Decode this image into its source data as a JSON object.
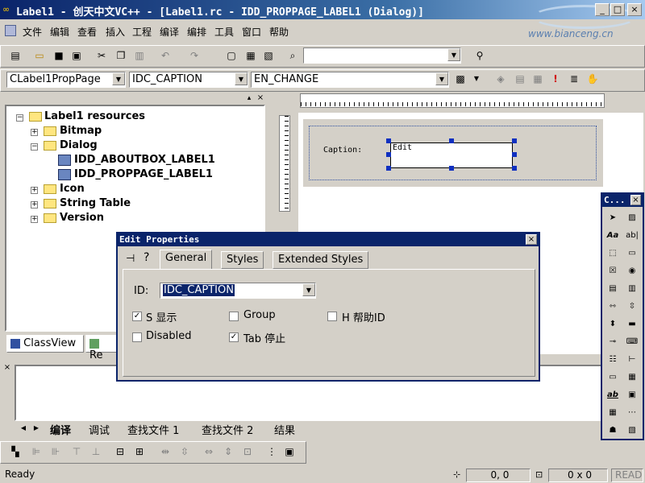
{
  "window": {
    "title": "Label1 - 创天中文VC++ - [Label1.rc - IDD_PROPPAGE_LABEL1 (Dialog)]",
    "min_glyph": "_",
    "max_glyph": "□",
    "close_glyph": "×",
    "watermark": "www.bianceng.cn"
  },
  "menu": [
    "文件",
    "编辑",
    "查看",
    "插入",
    "工程",
    "编译",
    "编排",
    "工具",
    "窗口",
    "帮助"
  ],
  "toolbar": {
    "find_combo_value": "",
    "class_combo": "CLabel1PropPage",
    "id_combo": "IDC_CAPTION",
    "message_combo": "EN_CHANGE"
  },
  "tree": {
    "root": "Label1 resources",
    "items": [
      {
        "label": "Bitmap",
        "level": 1,
        "kind": "folder",
        "expanded": false
      },
      {
        "label": "Dialog",
        "level": 1,
        "kind": "folder",
        "expanded": true
      },
      {
        "label": "IDD_ABOUTBOX_LABEL1",
        "level": 2,
        "kind": "dialog"
      },
      {
        "label": "IDD_PROPPAGE_LABEL1",
        "level": 2,
        "kind": "dialog"
      },
      {
        "label": "Icon",
        "level": 1,
        "kind": "folder",
        "expanded": false
      },
      {
        "label": "String Table",
        "level": 1,
        "kind": "folder",
        "expanded": false
      },
      {
        "label": "Version",
        "level": 1,
        "kind": "folder",
        "expanded": false
      }
    ]
  },
  "pane_tabs": {
    "classview": "ClassView",
    "resourceview": "Re"
  },
  "canvas": {
    "caption_label": "Caption:",
    "edit_text": "Edit"
  },
  "output_tabs": [
    "编译",
    "调试",
    "查找文件 1",
    "查找文件 2",
    "结果"
  ],
  "properties": {
    "title": "Edit Properties",
    "tabs": [
      "General",
      "Styles",
      "Extended Styles"
    ],
    "id_label": "ID:",
    "id_value": "IDC_CAPTION",
    "checkboxes": [
      {
        "label": "S 显示",
        "checked": true
      },
      {
        "label": "Group",
        "checked": false
      },
      {
        "label": "H 帮助ID",
        "checked": false
      },
      {
        "label": "Disabled",
        "checked": false
      },
      {
        "label": "Tab 停止",
        "checked": true
      }
    ]
  },
  "palette": {
    "title": "C..."
  },
  "status": {
    "ready": "Ready",
    "position": "0, 0",
    "size": "0 x 0",
    "mode": "READ"
  },
  "colors": {
    "titlebar": "#0a246a",
    "face": "#d4d0c8",
    "selection": "#0a246a"
  }
}
